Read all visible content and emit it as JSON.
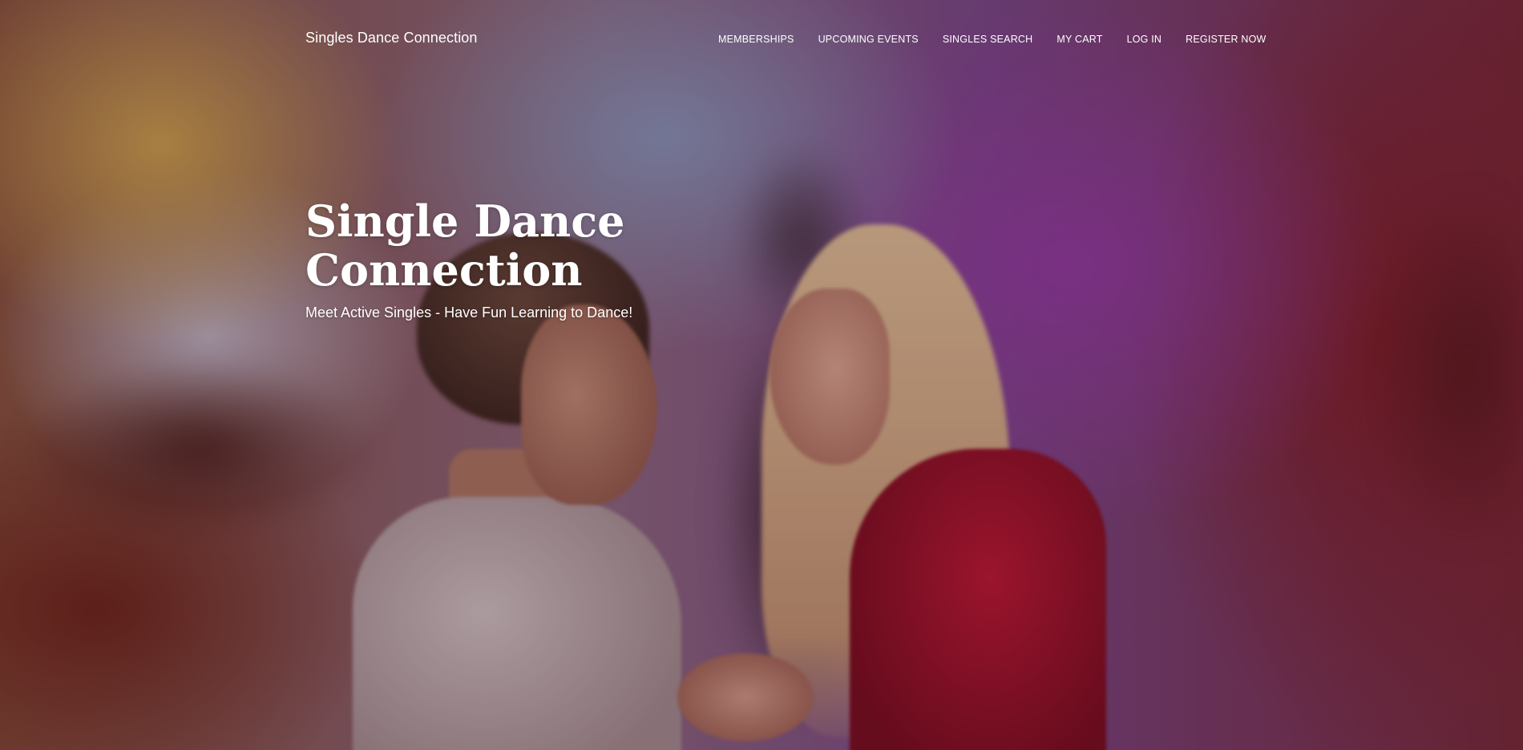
{
  "site": {
    "brand": "Singles Dance Connection"
  },
  "nav": {
    "items": [
      {
        "label": "MEMBERSHIPS"
      },
      {
        "label": "UPCOMING EVENTS"
      },
      {
        "label": "SINGLES SEARCH"
      },
      {
        "label": "MY CART"
      },
      {
        "label": "LOG IN"
      },
      {
        "label": "REGISTER NOW"
      }
    ]
  },
  "hero": {
    "title": "Single Dance Connection",
    "tagline": "Meet Active Singles - Have Fun Learning to Dance!"
  },
  "colors": {
    "text": "#ffffff",
    "dress_red": "#c11836"
  }
}
